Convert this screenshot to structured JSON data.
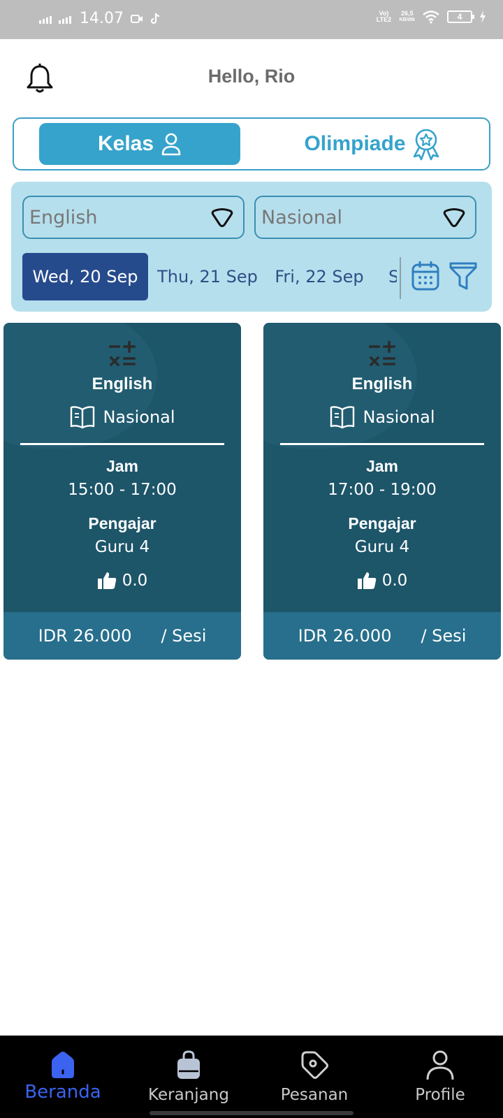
{
  "status_bar": {
    "time": "14.07",
    "network_label": "Vo) LTE2",
    "speed_value": "26,5",
    "speed_unit": "KB/dtk",
    "battery": "4"
  },
  "header": {
    "greeting": "Hello, Rio"
  },
  "segment": {
    "kelas_label": "Kelas",
    "olimpiade_label": "Olimpiade",
    "active": "Kelas"
  },
  "filters": {
    "subject": "English",
    "level": "Nasional",
    "dates": [
      "Wed, 20 Sep",
      "Thu, 21 Sep",
      "Fri, 22 Sep",
      "S"
    ],
    "selected_date": "Wed, 20 Sep"
  },
  "cards": [
    {
      "subject": "English",
      "level": "Nasional",
      "jam_label": "Jam",
      "jam_value": "15:00 - 17:00",
      "pengajar_label": "Pengajar",
      "pengajar_value": "Guru 4",
      "rating": "0.0",
      "price": "IDR 26.000",
      "per": "/ Sesi"
    },
    {
      "subject": "English",
      "level": "Nasional",
      "jam_label": "Jam",
      "jam_value": "17:00 - 19:00",
      "pengajar_label": "Pengajar",
      "pengajar_value": "Guru 4",
      "rating": "0.0",
      "price": "IDR 26.000",
      "per": "/ Sesi"
    }
  ],
  "nav": {
    "items": [
      "Beranda",
      "Keranjang",
      "Pesanan",
      "Profile"
    ],
    "active": "Beranda"
  },
  "colors": {
    "accent": "#36a3cc",
    "panel": "#b6dfed",
    "card": "#1d5569",
    "card_footer": "#276f8c",
    "active_date": "#264b8d",
    "nav_active": "#3b63f0"
  },
  "icons": [
    "bell-icon",
    "user-icon",
    "award-icon",
    "chevron-down-icon",
    "calendar-icon",
    "filter-icon",
    "math-icon",
    "book-icon",
    "thumbs-up-icon",
    "home-icon",
    "bag-icon",
    "tag-icon",
    "profile-icon"
  ]
}
